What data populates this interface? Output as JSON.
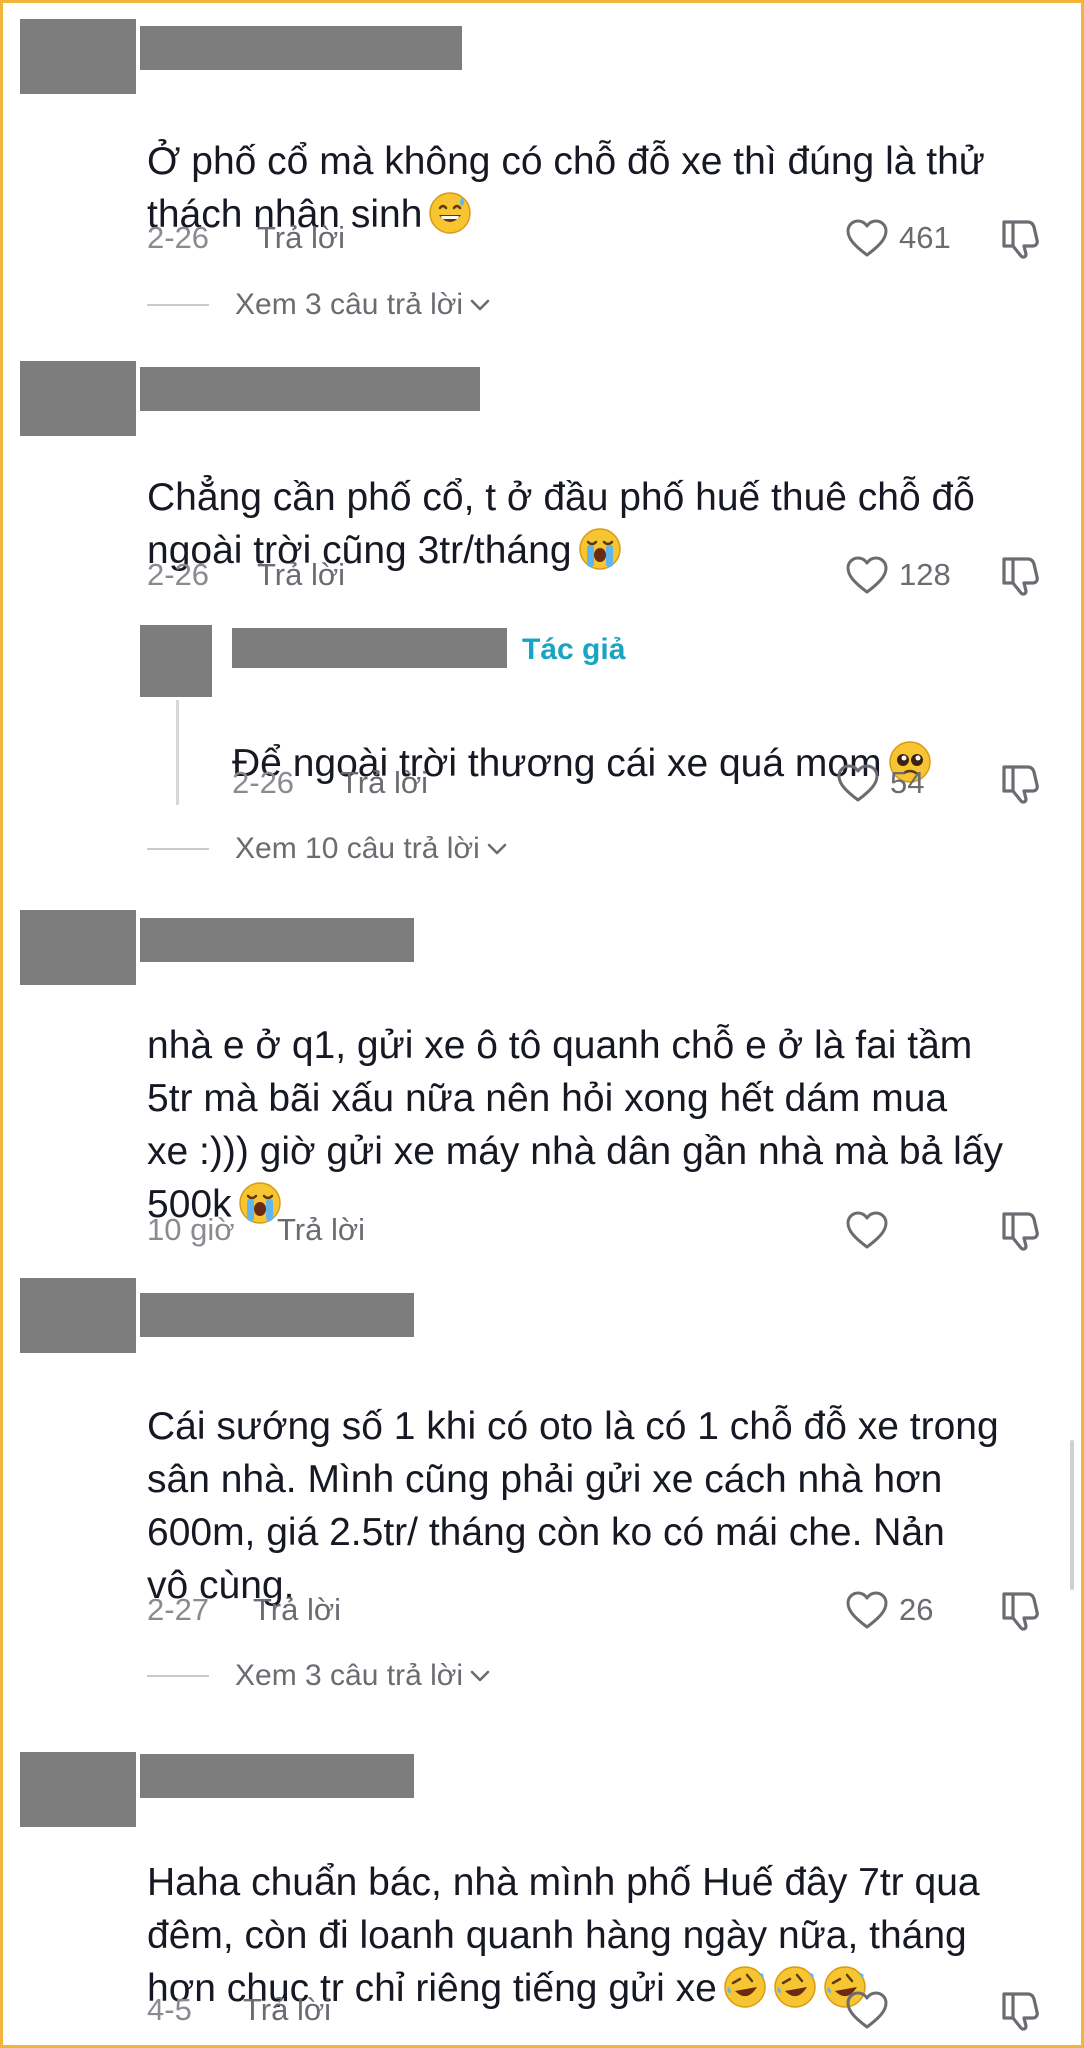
{
  "comments": [
    {
      "text": "Ở phố cổ mà không có chỗ đỗ xe thì đúng là thử\nthách nhân sinh",
      "date": "2-26",
      "reply_label": "Trả lời",
      "likes": "461",
      "view_replies": "Xem 3 câu trả lời"
    },
    {
      "text": "Chẳng cần phố cổ, t ở đầu phố huế thuê chỗ đỗ\nngoài trời cũng 3tr/tháng",
      "date": "2-26",
      "reply_label": "Trả lời",
      "likes": "128",
      "reply": {
        "author_badge": "Tác giả",
        "text": "Để ngoài trời thương cái xe quá mom",
        "date": "2-26",
        "reply_label": "Trả lời",
        "likes": "54"
      },
      "view_replies": "Xem 10 câu trả lời"
    },
    {
      "text": "nhà e ở q1, gửi xe ô tô quanh chỗ e ở là fai tầm\n5tr mà bãi xấu nữa nên hỏi xong hết dám mua\nxe :))) giờ gửi xe máy nhà dân gần nhà mà bả lấy\n500k",
      "date": "10 giờ",
      "reply_label": "Trả lời",
      "likes": ""
    },
    {
      "text": "Cái sướng số 1 khi có oto là có 1 chỗ đỗ xe trong\nsân nhà. Mình cũng phải gửi xe cách nhà hơn\n600m, giá 2.5tr/ tháng còn ko có mái che. Nản\nvô cùng.",
      "date": "2-27",
      "reply_label": "Trả lời",
      "likes": "26",
      "view_replies": "Xem 3 câu trả lời"
    },
    {
      "text": "Haha chuẩn bác, nhà mình phố Huế đây 7tr qua\nđêm, còn đi loanh quanh hàng ngày nữa, tháng\nhơn chục tr chỉ riêng tiếng gửi xe",
      "date": "4-5",
      "reply_label": "Trả lời",
      "likes": ""
    }
  ],
  "icons": {
    "heart": "heart-outline-icon",
    "dislike": "thumbs-down-icon",
    "chevron": "chevron-down-icon",
    "emoji_sweat": "grinning-sweat-emoji",
    "emoji_cry": "loudly-crying-emoji",
    "emoji_plead": "pleading-face-emoji",
    "emoji_rofl": "rolling-laughing-emoji"
  },
  "colors": {
    "frame": "#f2b43a",
    "author_badge": "#1aa4c4",
    "redaction": "#7d7d7d"
  }
}
